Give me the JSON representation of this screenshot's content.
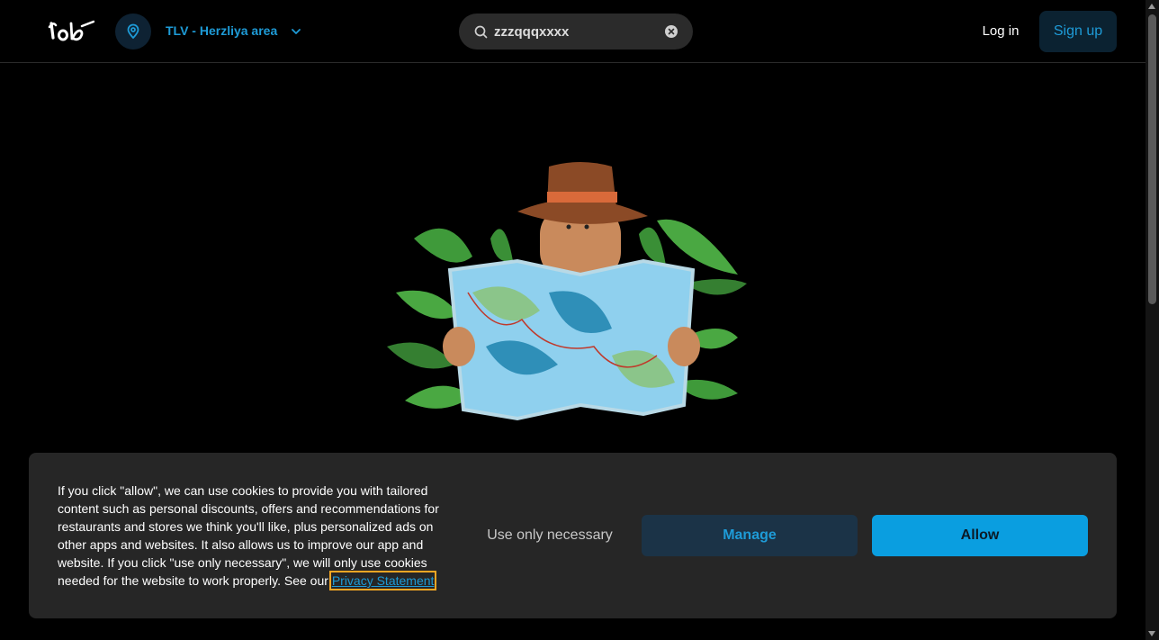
{
  "header": {
    "logo_icon": "wolt-logo",
    "location_icon": "location-pin-icon",
    "location_label": "TLV - Herzliya area",
    "location_chevron_icon": "chevron-down-icon",
    "search": {
      "icon": "search-icon",
      "value": "zzzqqqxxxx",
      "clear_icon": "close-circle-icon"
    },
    "login_label": "Log in",
    "signup_label": "Sign up"
  },
  "main": {
    "illustration_icon": "explorer-with-map-illustration"
  },
  "cookie_banner": {
    "text": "If you click \"allow\", we can use cookies to provide you with tailored content such as personal discounts, offers and recommendations for restaurants and stores we think you'll like, plus personalized ads on other apps and websites. It also allows us to improve our app and website. If you click \"use only necessary\", we will only use cookies needed for the website to work properly. See our ",
    "privacy_link": "Privacy Statement",
    "necessary_label": "Use only necessary",
    "manage_label": "Manage",
    "allow_label": "Allow"
  },
  "colors": {
    "accent": "#1e9bd7",
    "allow_bg": "#0a9ee0",
    "manage_bg": "#1b3347",
    "banner_bg": "#262626",
    "page_bg": "#000000"
  }
}
